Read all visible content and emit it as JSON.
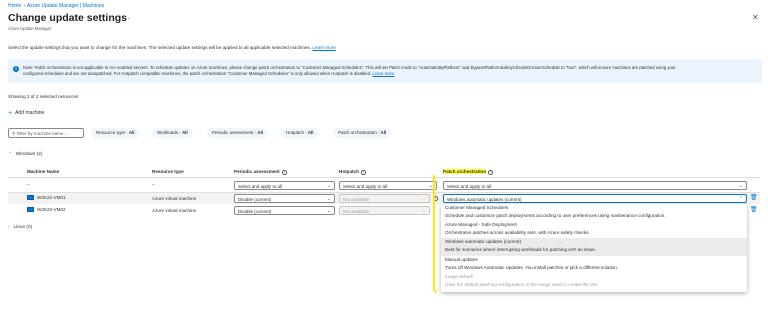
{
  "breadcrumb": [
    "Home",
    "Azure Update Manager | Machines"
  ],
  "page": {
    "title": "Change update settings",
    "subtitle": "Azure Update Manager",
    "description": "Select the update settings that you want to change for the machines. The selected update settings will be applied to all applicable selected machines.",
    "learn_more": "Learn more"
  },
  "note": {
    "line1": "Note: Patch orchestration is not applicable to Arc-enabled servers. To schedule updates on Azure machines, please change patch orchestration to \"Customer Managed Schedules\". This will set Patch mode to \"AutomaticByPlatform\" and BypassPlatformSafetyChecksOnUserSchedule to \"true\", which will ensure machines are patched using your",
    "line2": "configured schedules and are not autopatched. For Hotpatch compatible machines, the patch orchestration \"Customer Managed Schedules\" is only allowed when Hotpatch is disabled.",
    "learn_more": "Learn more"
  },
  "showing": "Showing 2 of 2 selected resources",
  "add_machine": "Add machine",
  "filter": {
    "placeholder": "Filter by machine name...",
    "pills": [
      {
        "label": "Resource type : ",
        "value": "All"
      },
      {
        "label": "Workloads : ",
        "value": "All"
      },
      {
        "label": "Periodic assessment : ",
        "value": "All"
      },
      {
        "label": "Hotpatch : ",
        "value": "All"
      },
      {
        "label": "Patch orchestration : ",
        "value": "All"
      }
    ]
  },
  "groups": {
    "windows": "Windows (2)",
    "linux": "Linux (0)"
  },
  "columns": {
    "machine": "Machine Name",
    "type": "Resource type",
    "periodic": "Periodic assessment",
    "hotpatch": "Hotpatch",
    "patch": "Patch orchestration"
  },
  "bulk_row": {
    "machine": "--",
    "type": "--",
    "periodic": "Select and apply to all",
    "hotpatch": "Select and apply to all",
    "patch": "Select and apply to all"
  },
  "rows": [
    {
      "name": "W2K22-VM01",
      "type": "Azure virtual machine",
      "periodic": "Disable (current)",
      "hotpatch": "Not available",
      "patch": "Windows automatic updates (current)"
    },
    {
      "name": "W2K22-VM02",
      "type": "Azure virtual machine",
      "periodic": "Disable (current)",
      "hotpatch": "Not available",
      "patch": ""
    }
  ],
  "dropdown_options": [
    {
      "title": "Customer Managed Schedules",
      "desc": "Schedule and customize patch deployments according to user preferences using maintenance configuration.",
      "state": "normal"
    },
    {
      "title": "Azure Managed - Safe Deployment",
      "desc": "Orchestrates patches across availability sets, with Azure safety checks.",
      "state": "normal"
    },
    {
      "title": "Windows automatic updates (current)",
      "desc": "Best for scenarios where interrupting workloads for patching isn't an issue.",
      "state": "selected"
    },
    {
      "title": "Manual updates",
      "desc": "Turns off Windows Automatic Updates. You install patches or pick a different solution.",
      "state": "normal"
    },
    {
      "title": "Image default",
      "desc": "Uses the default patching configuration in the image used to create the VM.",
      "state": "disabled"
    }
  ],
  "colors": {
    "accent": "#0078d4",
    "highlight": "#ffff35",
    "info_bar": "#ebf3fc"
  }
}
